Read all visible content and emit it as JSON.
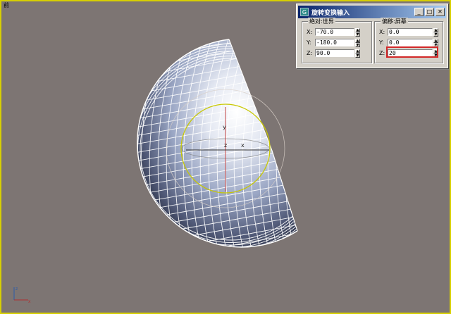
{
  "viewport": {
    "label": "前",
    "background": "#7d7573",
    "active_border_color": "#d8d000"
  },
  "dialog": {
    "title": "旋转变换输入",
    "icon": "3dsmax-app-icon",
    "controls": [
      "minimize",
      "maximize",
      "close"
    ],
    "absolute_group": {
      "label": "绝对:世界",
      "fields": [
        {
          "axis": "X:",
          "value": "-70.0"
        },
        {
          "axis": "Y:",
          "value": "-180.0"
        },
        {
          "axis": "Z:",
          "value": "90.0"
        }
      ]
    },
    "offset_group": {
      "label": "偏移:屏幕",
      "fields": [
        {
          "axis": "X:",
          "value": "0.0"
        },
        {
          "axis": "Y:",
          "value": "0.0"
        },
        {
          "axis": "Z:",
          "value": "20"
        }
      ],
      "highlighted_field": "Z:",
      "highlight_color": "#d22828"
    }
  },
  "gizmo": {
    "axis_labels": {
      "x": "x",
      "y": "y",
      "z": "z"
    },
    "colors": {
      "z_ring": "#c8c800",
      "x_axis": "#303030",
      "y_axis": "#c04040"
    }
  }
}
